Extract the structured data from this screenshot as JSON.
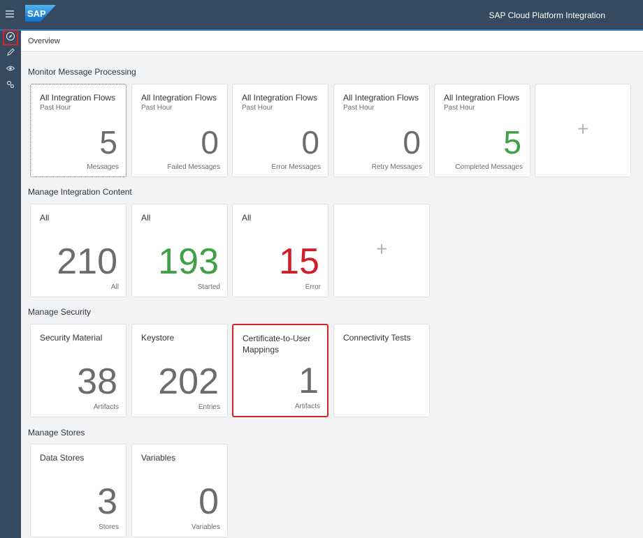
{
  "shell": {
    "logo_text": "SAP",
    "title": "SAP Cloud Platform Integration"
  },
  "sidenav": {
    "items": [
      {
        "name": "monitor",
        "icon": "compass-icon",
        "selected": true
      },
      {
        "name": "design",
        "icon": "pencil-icon",
        "selected": false
      },
      {
        "name": "discover",
        "icon": "eye-icon",
        "selected": false
      },
      {
        "name": "settings",
        "icon": "gears-icon",
        "selected": false
      }
    ]
  },
  "breadcrumb": "Overview",
  "sections": {
    "monitor": {
      "title": "Monitor Message Processing",
      "tiles": [
        {
          "title": "All Integration Flows",
          "subtitle": "Past Hour",
          "value": "5",
          "unit": "Messages"
        },
        {
          "title": "All Integration Flows",
          "subtitle": "Past Hour",
          "value": "0",
          "unit": "Failed Messages"
        },
        {
          "title": "All Integration Flows",
          "subtitle": "Past Hour",
          "value": "0",
          "unit": "Error Messages"
        },
        {
          "title": "All Integration Flows",
          "subtitle": "Past Hour",
          "value": "0",
          "unit": "Retry Messages"
        },
        {
          "title": "All Integration Flows",
          "subtitle": "Past Hour",
          "value": "5",
          "unit": "Completed Messages"
        }
      ],
      "add_label": "+"
    },
    "content": {
      "title": "Manage Integration Content",
      "tiles": [
        {
          "title": "All",
          "value": "210",
          "unit": "All"
        },
        {
          "title": "All",
          "value": "193",
          "unit": "Started"
        },
        {
          "title": "All",
          "value": "15",
          "unit": "Error"
        }
      ],
      "add_label": "+"
    },
    "security": {
      "title": "Manage Security",
      "tiles": [
        {
          "title": "Security Material",
          "value": "38",
          "unit": "Artifacts"
        },
        {
          "title": "Keystore",
          "value": "202",
          "unit": "Entries"
        },
        {
          "title": "Certificate-to-User Mappings",
          "value": "1",
          "unit": "Artifacts"
        },
        {
          "title": "Connectivity Tests"
        }
      ]
    },
    "stores": {
      "title": "Manage Stores",
      "tiles": [
        {
          "title": "Data Stores",
          "value": "3",
          "unit": "Stores"
        },
        {
          "title": "Variables",
          "value": "0",
          "unit": "Variables"
        }
      ]
    }
  },
  "colors": {
    "shell": "#354a5f",
    "accent": "#2b7ac0",
    "positive": "#3fa046",
    "negative": "#d11f2a",
    "highlight": "#d9232a"
  }
}
